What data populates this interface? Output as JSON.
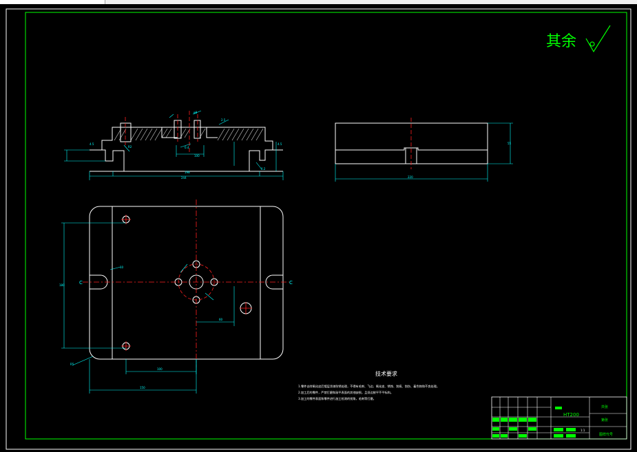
{
  "window": {
    "tab_label": ""
  },
  "drawing": {
    "colors": {
      "background": "#000000",
      "line": "#ffffff",
      "border": "#00ff00",
      "center": "#ff2020",
      "dimension": "#00ffff",
      "title_green": "#00ff00"
    },
    "surface_note": "其余",
    "material": "HT200",
    "tech_title": "技术要求",
    "tech_items": [
      "1.零件去除氧化皮后镀层涂漆防锈处理，不得有毛刺、飞边、氧化皮、锈蚀、划痕、划伤、着色物和不良处理。",
      "2.加工后的零件，严禁打磨和敲平表面的其他缺损，且须边按平不平标和。",
      "3.加工的零件表面和零件进行加工检测的锐角，毛刺等打磨。"
    ],
    "section_label_left": "C",
    "section_label_right": "C",
    "title_block": {
      "r1": "共张",
      "r2": "第张",
      "r3": "图样代号",
      "scale": "1:1"
    }
  }
}
